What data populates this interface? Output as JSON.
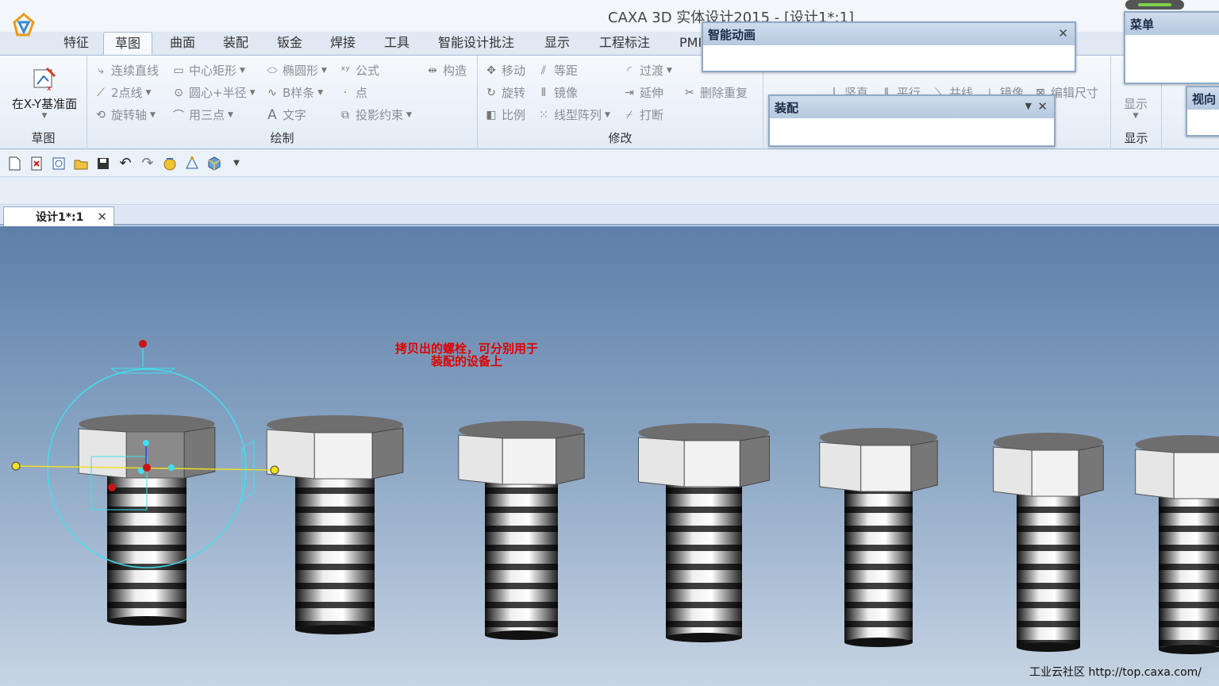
{
  "window": {
    "title": "CAXA 3D 实体设计2015 - [设计1*:1]"
  },
  "tabs": [
    {
      "label": "特征"
    },
    {
      "label": "草图"
    },
    {
      "label": "曲面"
    },
    {
      "label": "装配"
    },
    {
      "label": "钣金"
    },
    {
      "label": "焊接"
    },
    {
      "label": "工具"
    },
    {
      "label": "智能设计批注"
    },
    {
      "label": "显示"
    },
    {
      "label": "工程标注"
    },
    {
      "label": "PMI"
    }
  ],
  "active_tab": "草图",
  "ribbon": {
    "sketch_group": {
      "button": "在X-Y基准面",
      "label": "草图"
    },
    "draw_group": {
      "label": "绘制",
      "items": [
        {
          "label": "连续直线"
        },
        {
          "label": "中心矩形"
        },
        {
          "label": "椭圆形"
        },
        {
          "label": "公式"
        },
        {
          "label": "构造"
        },
        {
          "label": "2点线"
        },
        {
          "label": "圆心+半径"
        },
        {
          "label": "B样条"
        },
        {
          "label": "点"
        },
        {
          "label": "旋转轴"
        },
        {
          "label": "用三点"
        },
        {
          "label": "文字"
        },
        {
          "label": "投影约束"
        }
      ]
    },
    "modify_group": {
      "label": "修改",
      "items": [
        {
          "label": "移动"
        },
        {
          "label": "等距"
        },
        {
          "label": "过渡"
        },
        {
          "label": "旋转"
        },
        {
          "label": "镜像"
        },
        {
          "label": "延伸"
        },
        {
          "label": "删除重复"
        },
        {
          "label": "比例"
        },
        {
          "label": "线型阵列"
        },
        {
          "label": "打断"
        }
      ]
    },
    "constraint_group": {
      "items": [
        {
          "label": "竖直"
        },
        {
          "label": "平行"
        },
        {
          "label": "共线"
        },
        {
          "label": "镜像"
        },
        {
          "label": "编辑尺寸"
        }
      ]
    },
    "display_group": {
      "button": "显示",
      "label": "显示"
    }
  },
  "panels": {
    "smart_animation": {
      "title": "智能动画"
    },
    "assembly": {
      "title": "装配"
    },
    "menu": {
      "title": "菜单"
    },
    "view": {
      "title": "视向"
    }
  },
  "document_tab": {
    "label": "设计1*:1"
  },
  "viewport": {
    "annotation_line1": "拷贝出的螺栓，可分别用于",
    "annotation_line2": "装配的设备上",
    "watermark": "工业云社区 http://top.caxa.com/"
  },
  "colors": {
    "annotation": "#e00000",
    "selection": "#40e0f0",
    "handle_red": "#c81414",
    "handle_yellow": "#f0e020"
  }
}
